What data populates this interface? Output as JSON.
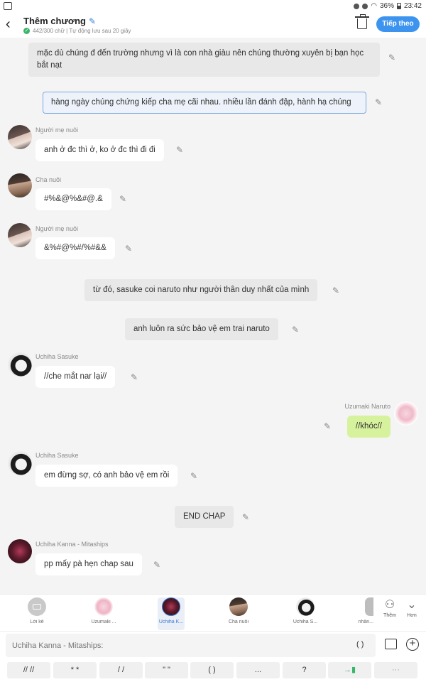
{
  "statusbar": {
    "battery": "36%",
    "time": "23:42"
  },
  "header": {
    "title": "Thêm chương",
    "subtitle": "442/300 chữ | Tự động lưu sau 20 giây",
    "next_label": "Tiếp theo"
  },
  "messages": [
    {
      "type": "narration",
      "text": "mặc dù chúng đ đến trường nhưng vì là con nhà giàu nên chúng thường xuyên bị bạn học bắt nạt"
    },
    {
      "type": "narration",
      "text": "hàng ngày chúng chứng kiếp cha mẹ cãi nhau. nhiều lần đánh đập, hành hạ chúng",
      "selected": true
    },
    {
      "type": "left",
      "name": "Người mẹ nuôi",
      "text": "anh ở đc thì ở, ko ở đc thì đi đi"
    },
    {
      "type": "left",
      "name": "Cha nuôi",
      "text": "#%&@%&#@.&"
    },
    {
      "type": "left",
      "name": "Người mẹ nuôi",
      "text": "&%#@%#/%#&&"
    },
    {
      "type": "narration",
      "text": "từ đó, sasuke coi naruto như người thân duy nhất của mình"
    },
    {
      "type": "narration",
      "text": "anh luôn ra sức bảo vệ em trai naruto"
    },
    {
      "type": "left",
      "name": "Uchiha Sasuke",
      "text": "//che mắt nar lại//"
    },
    {
      "type": "right",
      "name": "Uzumaki Naruto",
      "text": "//khóc//"
    },
    {
      "type": "left",
      "name": "Uchiha Sasuke",
      "text": "em đừng sợ, có anh bảo vệ em rồi"
    },
    {
      "type": "narration",
      "text": "END CHAP"
    },
    {
      "type": "left",
      "name": "Uchiha Kanna - Mitaships",
      "text": "pp mấy pà hẹn chap sau"
    }
  ],
  "characters": [
    {
      "label": "Lời kể",
      "icon": "narrator-icon"
    },
    {
      "label": "Uzumaki ...",
      "icon": "avatar-naruto"
    },
    {
      "label": "Uchiha K...",
      "icon": "avatar-kanna",
      "active": true
    },
    {
      "label": "Cha nuôi",
      "icon": "avatar-father"
    },
    {
      "label": "Uchiha S...",
      "icon": "avatar-sasuke"
    },
    {
      "label": "nhân...",
      "icon": "avatar-partial"
    }
  ],
  "side_buttons": {
    "add": "Thêm",
    "more": "Hơn"
  },
  "input": {
    "placeholder": "Uchiha Kanna - Mitaships:",
    "paren": "( )"
  },
  "symbols": [
    "// //",
    "* *",
    "/ /",
    "\" \"",
    "( )",
    "...",
    "?",
    "→▮",
    "···"
  ],
  "colors": {
    "accent": "#3d94ee",
    "green_bubble": "#d7f29c",
    "selected_border": "#7ca6dd"
  }
}
